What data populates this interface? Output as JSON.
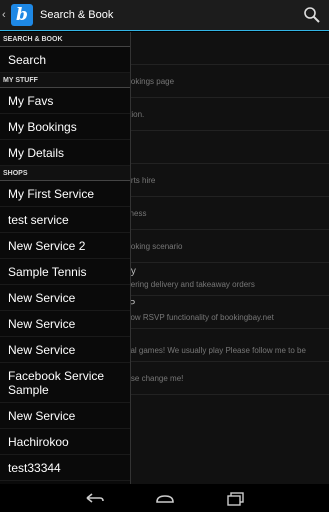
{
  "actionbar": {
    "back_glyph": "‹",
    "logo_letter": "b",
    "title": "Search & Book",
    "search_icon": "search-icon"
  },
  "drawer": {
    "sections": [
      {
        "header": "SEARCH & BOOK",
        "items": [
          "Search"
        ]
      },
      {
        "header": "MY STUFF",
        "items": [
          "My Favs",
          "My Bookings",
          "My Details"
        ]
      },
      {
        "header": "SHOPS",
        "items": [
          "My First Service",
          "test service",
          "New Service 2",
          "Sample Tennis",
          "New Service",
          "New Service",
          "New Service",
          "Facebook Service Sample",
          "New Service",
          "Hachirokoo",
          "test33344"
        ]
      }
    ]
  },
  "background": {
    "rows": [
      {
        "title": "",
        "desc": "n."
      },
      {
        "title": "",
        "desc": "bookings page"
      },
      {
        "title": "",
        "desc": "ration."
      },
      {
        "title": "",
        "desc": "ce"
      },
      {
        "title": "",
        "desc": "ourts hire"
      },
      {
        "title": "",
        "desc": "isiness"
      },
      {
        "title": "",
        "desc": "booking scenario"
      },
      {
        "title": "ery",
        "desc": "offering delivery and takeaway orders"
      },
      {
        "title": "VP",
        "desc": "show RSVP functionality of bookingbay.net"
      },
      {
        "title": "n",
        "desc": "sual games! We usually play Please follow me to be"
      },
      {
        "title": "",
        "desc": "ease change me!"
      }
    ]
  },
  "navbar": {
    "back_icon": "back-icon",
    "home_icon": "home-icon",
    "recents_icon": "recent-apps-icon"
  }
}
